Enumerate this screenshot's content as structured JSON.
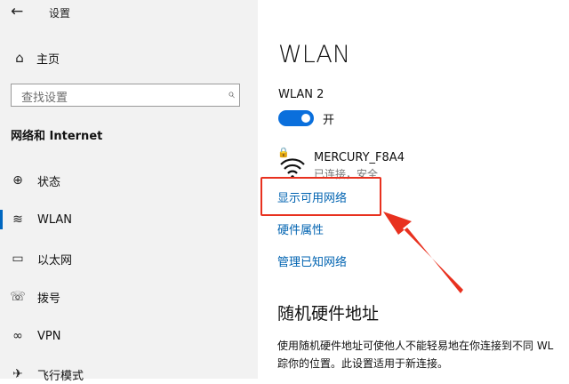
{
  "window": {
    "title": "设置",
    "back_icon": "back-arrow-icon"
  },
  "sidebar": {
    "home_label": "主页",
    "search_placeholder": "查找设置",
    "section_title": "网络和 Internet",
    "items": [
      {
        "label": "状态",
        "icon": "globe-icon",
        "selected": false
      },
      {
        "label": "WLAN",
        "icon": "wifi-icon",
        "selected": true
      },
      {
        "label": "以太网",
        "icon": "ethernet-icon",
        "selected": false
      },
      {
        "label": "拨号",
        "icon": "dialup-icon",
        "selected": false
      },
      {
        "label": "VPN",
        "icon": "vpn-icon",
        "selected": false
      },
      {
        "label": "飞行模式",
        "icon": "airplane-icon",
        "selected": false
      }
    ]
  },
  "main": {
    "heading": "WLAN",
    "adapter_name": "WLAN 2",
    "toggle": {
      "state": "on",
      "label": "开"
    },
    "network": {
      "ssid": "MERCURY_F8A4",
      "status": "已连接，安全"
    },
    "links": {
      "show_available": "显示可用网络",
      "hardware_properties": "硬件属性",
      "manage_known": "管理已知网络"
    },
    "random_hw": {
      "heading": "随机硬件地址",
      "desc_line1": "使用随机硬件地址可使他人不能轻易地在你连接到不同 WL",
      "desc_line2": "踪你的位置。此设置适用于新连接。"
    }
  },
  "colors": {
    "accent": "#0067c0",
    "link": "#0063b1",
    "highlight": "#e8311f",
    "sidebar_bg": "#f2f2f2"
  }
}
